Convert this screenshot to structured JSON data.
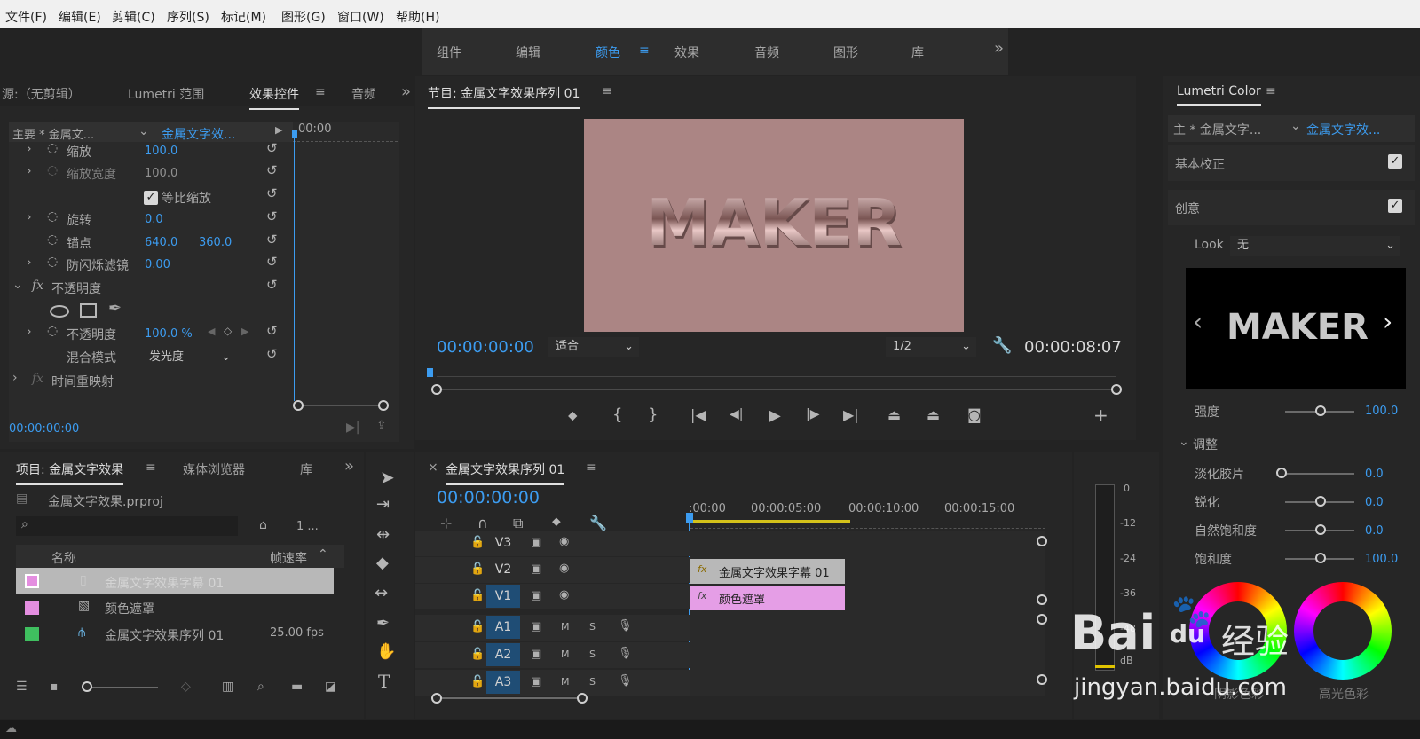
{
  "menu": [
    "文件(F)",
    "编辑(E)",
    "剪辑(C)",
    "序列(S)",
    "标记(M)",
    "图形(G)",
    "窗口(W)",
    "帮助(H)"
  ],
  "workspaces": [
    "组件",
    "编辑",
    "颜色",
    "效果",
    "音频",
    "图形",
    "库"
  ],
  "effect_panel": {
    "tabs": [
      "源:（无剪辑）",
      "Lumetri 范围",
      "效果控件",
      "音频"
    ],
    "master_label": "主要 * 金属文...",
    "clip_label": "金属文字效...",
    "timecode_ruler": "00:00",
    "rows": {
      "scale": {
        "label": "缩放",
        "value": "100.0"
      },
      "scale_width": {
        "label": "缩放宽度",
        "value": "100.0"
      },
      "uniform": {
        "label": "等比缩放"
      },
      "rotation": {
        "label": "旋转",
        "value": "0.0"
      },
      "anchor": {
        "label": "锚点",
        "x": "640.0",
        "y": "360.0"
      },
      "antiflicker": {
        "label": "防闪烁滤镜",
        "value": "0.00"
      },
      "opacity_group": {
        "label": "不透明度"
      },
      "opacity": {
        "label": "不透明度",
        "value": "100.0 %"
      },
      "blend": {
        "label": "混合模式",
        "value": "发光度"
      },
      "time_remap": {
        "label": "时间重映射"
      }
    },
    "fx": "fx",
    "bottom_timecode": "00:00:00:00"
  },
  "program": {
    "title": "节目: 金属文字效果序列 01",
    "video_text": "MAKER",
    "video_bg": "#ab8584",
    "timecode_left": "00:00:00:00",
    "fit": "适合",
    "resolution": "1/2",
    "timecode_right": "00:00:08:07"
  },
  "project": {
    "tabs": [
      "项目: 金属文字效果",
      "媒体浏览器",
      "库"
    ],
    "file": "金属文字效果.prproj",
    "count": "1 ...",
    "col_name": "名称",
    "col_fps": "帧速率",
    "items": [
      {
        "name": "金属文字效果字幕 01",
        "fps": "",
        "color": "#e48ee0"
      },
      {
        "name": "颜色遮罩",
        "fps": "",
        "color": "#e48ee0"
      },
      {
        "name": "金属文字效果序列 01",
        "fps": "25.00 fps",
        "color": "#3fbf5f"
      }
    ]
  },
  "timeline": {
    "title": "金属文字效果序列 01",
    "timecode": "00:00:00:00",
    "ruler": [
      ":00:00",
      "00:00:05:00",
      "00:00:10:00",
      "00:00:15:00"
    ],
    "tracks": [
      "V3",
      "V2",
      "V1",
      "A1",
      "A2",
      "A3"
    ],
    "m": "M",
    "s": "S",
    "clips": [
      {
        "label": "金属文字效果字幕 01",
        "color": "#b8b8b8"
      },
      {
        "label": "颜色遮罩",
        "color": "#e59ee6"
      }
    ]
  },
  "meter": [
    "0",
    "-12",
    "-24",
    "-36",
    "-48",
    "dB"
  ],
  "lumetri": {
    "title": "Lumetri Color",
    "master": "主 * 金属文字...",
    "clip": "金属文字效...",
    "basic": "基本校正",
    "creative": "创意",
    "look_label": "Look",
    "look_value": "无",
    "preview_text": "MAKER",
    "intensity": {
      "label": "强度",
      "value": "100.0"
    },
    "adjust": "调整",
    "faded": {
      "label": "淡化胶片",
      "value": "0.0"
    },
    "sharpen": {
      "label": "锐化",
      "value": "0.0"
    },
    "vibrance": {
      "label": "自然饱和度",
      "value": "0.0"
    },
    "saturation": {
      "label": "饱和度",
      "value": "100.0"
    },
    "shadow": "阴影色彩",
    "highlight": "高光色彩"
  },
  "watermark": {
    "brand": "Bai",
    "du": "du",
    "jingyan": "经验",
    "url": "jingyan.baidu.com"
  }
}
